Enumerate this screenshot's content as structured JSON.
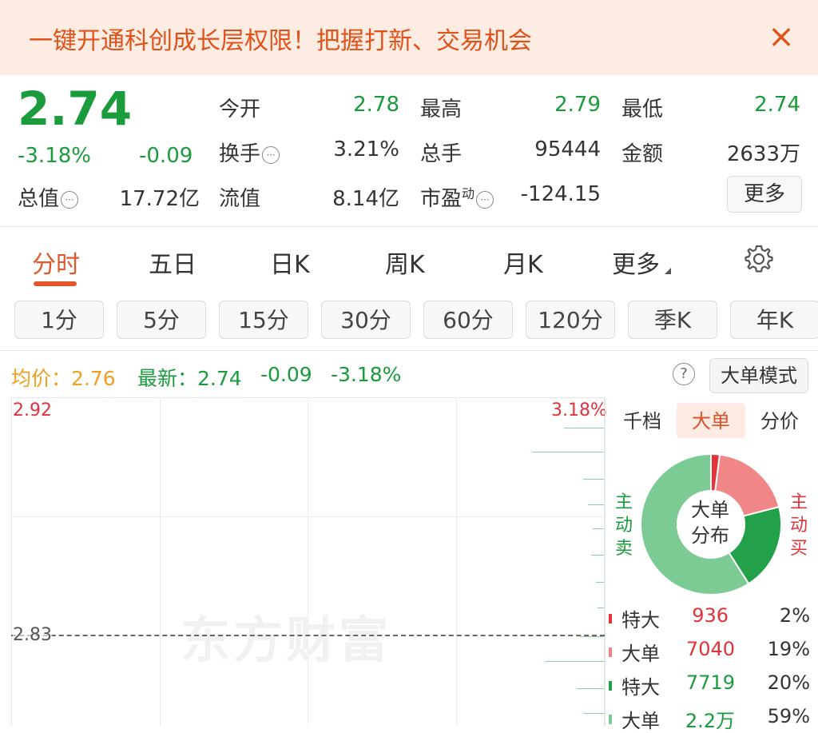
{
  "banner": {
    "text": "一键开通科创成长层权限！把握打新、交易机会",
    "close": "×"
  },
  "quote": {
    "price": "2.74",
    "change_pct": "-3.18%",
    "change": "-0.09",
    "fields": {
      "open_label": "今开",
      "open": "2.78",
      "high_label": "最高",
      "high": "2.79",
      "low_label": "最低",
      "low": "2.74",
      "turnover_label": "换手",
      "turnover": "3.21%",
      "volume_label": "总手",
      "volume": "95444",
      "amount_label": "金额",
      "amount": "2633万",
      "mcap_label": "总值",
      "mcap": "17.72亿",
      "float_label": "流值",
      "float": "8.14亿",
      "pe_label": "市盈",
      "pe_sup": "动",
      "pe": "-124.15"
    },
    "more_label": "更多",
    "dots": "⋯"
  },
  "tabs": [
    {
      "label": "分时",
      "active": true
    },
    {
      "label": "五日"
    },
    {
      "label": "日K"
    },
    {
      "label": "周K"
    },
    {
      "label": "月K"
    },
    {
      "label": "更多"
    }
  ],
  "periods": [
    "1分",
    "5分",
    "15分",
    "30分",
    "60分",
    "120分",
    "季K",
    "年K"
  ],
  "info_line": {
    "avg_label": "均价：",
    "avg": "2.76",
    "latest_label": "最新：",
    "latest": "2.74",
    "change": "-0.09",
    "change_pct": "-3.18%",
    "help": "?",
    "mode_button": "大单模式"
  },
  "chart": {
    "high_label": "2.92",
    "pct_label": "3.18%",
    "pre_close_label": "2.83",
    "watermark": "东方财富",
    "colors": {
      "up": "#e2323a",
      "down": "#1a9b3c",
      "avg": "#f0a020"
    }
  },
  "right_panel": {
    "tabs": [
      {
        "label": "千档"
      },
      {
        "label": "大单",
        "active": true
      },
      {
        "label": "分价"
      }
    ],
    "left_side": [
      "主",
      "动",
      "卖"
    ],
    "right_side": [
      "主",
      "动",
      "买"
    ],
    "donut_center": [
      "大单",
      "分布"
    ],
    "legend": [
      {
        "name": "特大",
        "value": "936",
        "pct": "2%",
        "color": "#e2323a",
        "kind": "buy"
      },
      {
        "name": "大单",
        "value": "7040",
        "pct": "19%",
        "color": "#f08686",
        "kind": "buy"
      },
      {
        "name": "特大",
        "value": "7719",
        "pct": "20%",
        "color": "#22a04a",
        "kind": "sell"
      },
      {
        "name": "大单",
        "value": "2.2万",
        "pct": "59%",
        "color": "#7ccb95",
        "kind": "sell"
      }
    ],
    "donut_fractions": [
      0.02,
      0.19,
      0.2,
      0.59
    ]
  }
}
